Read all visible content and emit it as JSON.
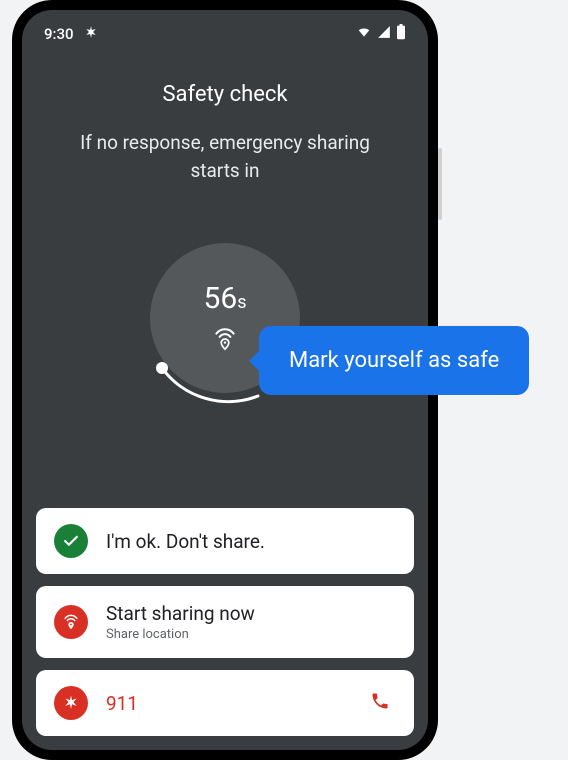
{
  "status_bar": {
    "time": "9:30",
    "notif_icon": "asterisk"
  },
  "screen": {
    "title": "Safety check",
    "subtitle": "If no response, emergency sharing starts in",
    "countdown_value": "56",
    "countdown_unit": "s"
  },
  "actions": {
    "ok": {
      "label": "I'm ok. Don't share."
    },
    "share": {
      "label": "Start sharing now",
      "sub": "Share location"
    },
    "emergency": {
      "label": "911"
    }
  },
  "tooltip": {
    "text": "Mark yourself as safe"
  },
  "colors": {
    "accent_blue": "#1a73e8",
    "danger_red": "#d93025",
    "ok_green": "#198038"
  }
}
